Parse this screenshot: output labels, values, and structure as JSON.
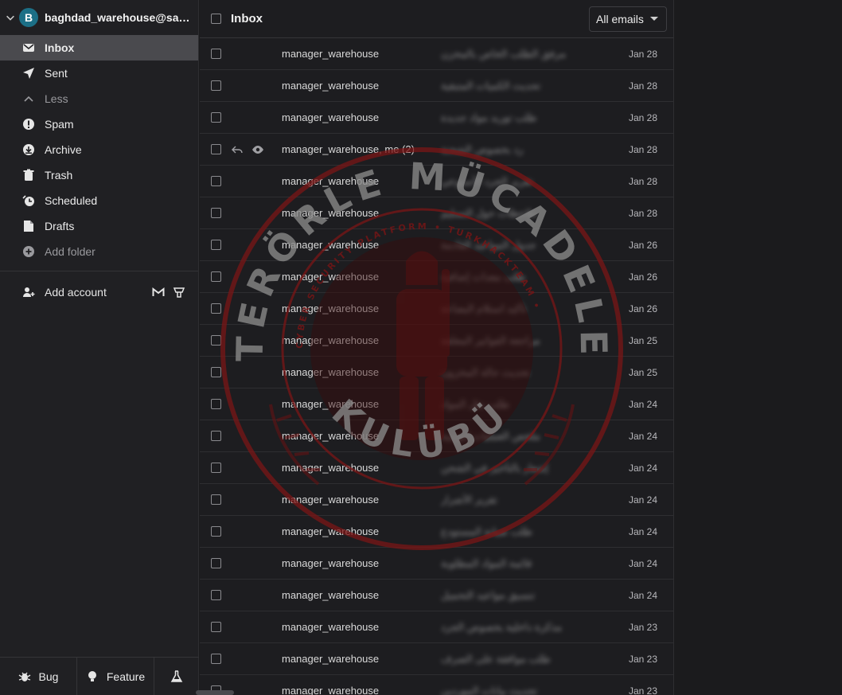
{
  "account": {
    "initial": "B",
    "email": "baghdad_warehouse@sari..."
  },
  "nav": [
    {
      "label": "Inbox",
      "icon": "inbox-icon",
      "active": true
    },
    {
      "label": "Sent",
      "icon": "send-icon"
    },
    {
      "label": "Less",
      "icon": "chevron-up-icon",
      "dim": true
    },
    {
      "label": "Spam",
      "icon": "spam-icon"
    },
    {
      "label": "Archive",
      "icon": "archive-icon"
    },
    {
      "label": "Trash",
      "icon": "trash-icon"
    },
    {
      "label": "Scheduled",
      "icon": "clock-icon"
    },
    {
      "label": "Drafts",
      "icon": "draft-icon"
    },
    {
      "label": "Add folder",
      "icon": "plus-icon",
      "dim": true
    }
  ],
  "add_account": {
    "label": "Add account"
  },
  "bottom": {
    "bug": "Bug",
    "feature": "Feature"
  },
  "list": {
    "title": "Inbox",
    "filter": "All emails",
    "rows": [
      {
        "sender": "manager_warehouse",
        "subject": "مرفق الطلب الخاص بالمخزن",
        "date": "Jan 28"
      },
      {
        "sender": "manager_warehouse",
        "subject": "تحديث الكميات المتبقية",
        "date": "Jan 28"
      },
      {
        "sender": "manager_warehouse",
        "subject": "طلب توريد مواد جديدة",
        "date": "Jan 28"
      },
      {
        "sender": "manager_warehouse, me (2)",
        "subject": "رد بخصوص الشحنة",
        "date": "Jan 28",
        "thread": true
      },
      {
        "sender": "manager_warehouse",
        "subject": "تقرير الجرد الأسبوعي",
        "date": "Jan 28"
      },
      {
        "sender": "manager_warehouse",
        "subject": "ملاحظات حول التسليم",
        "date": "Jan 28"
      },
      {
        "sender": "manager_warehouse",
        "subject": "جدول المواعيد القادمة",
        "date": "Jan 26"
      },
      {
        "sender": "manager_warehouse",
        "subject": "طلب معدات إضافية",
        "date": "Jan 26"
      },
      {
        "sender": "manager_warehouse",
        "subject": "تأكيد استلام البضاعة",
        "date": "Jan 26"
      },
      {
        "sender": "manager_warehouse",
        "subject": "مراجعة الفواتير المعلقة",
        "date": "Jan 25"
      },
      {
        "sender": "manager_warehouse",
        "subject": "تحديث حالة المخزون",
        "date": "Jan 25"
      },
      {
        "sender": "manager_warehouse",
        "subject": "طلب نقل المواد",
        "date": "Jan 24"
      },
      {
        "sender": "manager_warehouse",
        "subject": "ملخص العمليات اليومية",
        "date": "Jan 24"
      },
      {
        "sender": "manager_warehouse",
        "subject": "إشعار بالتأخير في الشحن",
        "date": "Jan 24"
      },
      {
        "sender": "manager_warehouse",
        "subject": "تقرير الأضرار",
        "date": "Jan 24"
      },
      {
        "sender": "manager_warehouse",
        "subject": "طلب صيانة المستودع",
        "date": "Jan 24"
      },
      {
        "sender": "manager_warehouse",
        "subject": "قائمة المواد المطلوبة",
        "date": "Jan 24"
      },
      {
        "sender": "manager_warehouse",
        "subject": "تنسيق مواعيد التحميل",
        "date": "Jan 24"
      },
      {
        "sender": "manager_warehouse",
        "subject": "مذكرة داخلية بخصوص الجرد",
        "date": "Jan 23"
      },
      {
        "sender": "manager_warehouse",
        "subject": "طلب موافقة على الصرف",
        "date": "Jan 23"
      },
      {
        "sender": "manager_warehouse",
        "subject": "تحديث بيانات الموردين",
        "date": "Jan 23"
      }
    ]
  },
  "watermark": {
    "top_text": "TERÖRLE MÜCADELE",
    "bottom_text": "KULÜBÜ",
    "ring_text": "CYBER SECURITY PLATFORM • TURKHACKTEAM •",
    "color": "#8b1a1a"
  }
}
